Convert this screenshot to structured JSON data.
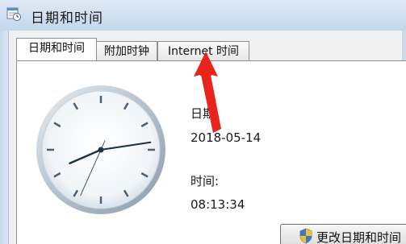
{
  "window": {
    "title": "日期和时间",
    "icon": "date-time-settings-icon"
  },
  "tabs": [
    {
      "label": "日期和时间",
      "active": true
    },
    {
      "label": "附加时钟",
      "active": false
    },
    {
      "label": "Internet 时间",
      "active": false
    }
  ],
  "clock": {
    "hour": 8,
    "minute": 13,
    "second": 34
  },
  "date_section": {
    "label": "日期",
    "value": "2018-05-14"
  },
  "time_section": {
    "label": "时间:",
    "value": "08:13:34"
  },
  "buttons": {
    "change_datetime": "更改日期和时间"
  },
  "annotation": {
    "arrow_color": "#e8251d",
    "points_to": "Internet 时间"
  }
}
